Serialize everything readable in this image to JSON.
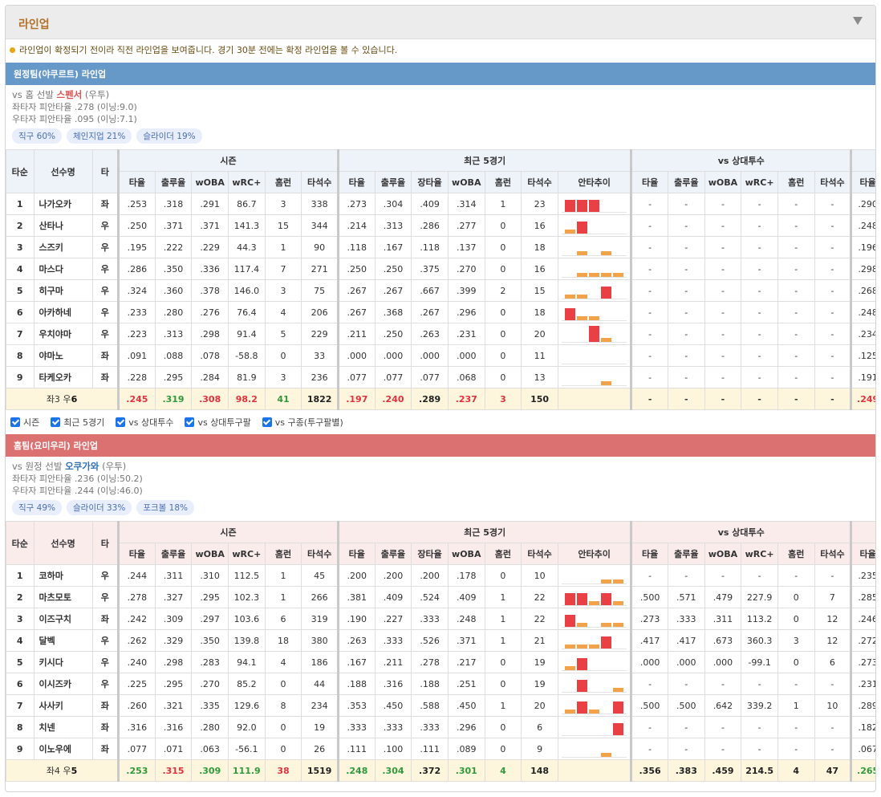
{
  "panel": {
    "title": "라인업",
    "notice": "라인업이 확정되기 전이라 직전 라인업을 보여줍니다. 경기 30분 전에는 확정 라인업을 볼 수 있습니다."
  },
  "colors": {
    "away_bar": "#6698c8",
    "home_bar": "#dc7171",
    "total_row": "#fdf6dc",
    "bar_red": "#e84045",
    "bar_orange": "#f2a34a",
    "accent_title": "#b2722a"
  },
  "headers": {
    "order": "타순",
    "name": "선수명",
    "hand": "타",
    "season": "시즌",
    "recent": "최근 5경기",
    "vs_pitcher": "vs 상대투수",
    "avg": "타율",
    "obp": "출루율",
    "slg": "장타율",
    "woba": "wOBA",
    "wrc": "wRC+",
    "hr": "홈런",
    "ab": "타석수",
    "trend": "안타추이"
  },
  "filters": [
    "시즌",
    "최근 5경기",
    "vs 상대투수",
    "vs 상대투구팔",
    "vs 구종(투구팔별)"
  ],
  "away": {
    "title": "원정팀(야쿠르트) 라인업",
    "vs_prefix": "vs 홈 선발 ",
    "pitcher_name": "스펜서",
    "pitcher_hand": " (우투)",
    "split_left": "좌타자 피안타율 .278 (이닝:9.0)",
    "split_right": "우타자 피안타율 .095 (이닝:7.1)",
    "tags": [
      "직구 60%",
      "체인지업 21%",
      "슬라이더 19%"
    ],
    "rows": [
      {
        "order": "1",
        "name": "나가오카",
        "hand": "좌",
        "s": [
          ".253",
          ".318",
          ".291",
          "86.7",
          "3",
          "338"
        ],
        "r": [
          ".273",
          ".304",
          ".409",
          ".314",
          "1",
          "23"
        ],
        "trend": [
          "r3",
          "r3",
          "r3",
          "n",
          "n"
        ],
        "v": [
          "-",
          "-",
          "-",
          "-",
          "-",
          "-"
        ],
        "last": ".290"
      },
      {
        "order": "2",
        "name": "산타나",
        "hand": "우",
        "s": [
          ".250",
          ".371",
          ".371",
          "141.3",
          "15",
          "344"
        ],
        "r": [
          ".214",
          ".313",
          ".286",
          ".277",
          "0",
          "16"
        ],
        "trend": [
          "o1",
          "r3",
          "n",
          "n",
          "n"
        ],
        "v": [
          "-",
          "-",
          "-",
          "-",
          "-",
          "-"
        ],
        "last": ".248"
      },
      {
        "order": "3",
        "name": "스즈키",
        "hand": "우",
        "s": [
          ".195",
          ".222",
          ".229",
          "44.3",
          "1",
          "90"
        ],
        "r": [
          ".118",
          ".167",
          ".118",
          ".137",
          "0",
          "18"
        ],
        "trend": [
          "n",
          "o1",
          "n",
          "o1",
          "n"
        ],
        "v": [
          "-",
          "-",
          "-",
          "-",
          "-",
          "-"
        ],
        "last": ".196"
      },
      {
        "order": "4",
        "name": "마스다",
        "hand": "우",
        "s": [
          ".286",
          ".350",
          ".336",
          "117.4",
          "7",
          "271"
        ],
        "r": [
          ".250",
          ".250",
          ".375",
          ".270",
          "0",
          "16"
        ],
        "trend": [
          "n",
          "o1",
          "o1",
          "o1",
          "o1"
        ],
        "v": [
          "-",
          "-",
          "-",
          "-",
          "-",
          "-"
        ],
        "last": ".298"
      },
      {
        "order": "5",
        "name": "히구마",
        "hand": "우",
        "s": [
          ".324",
          ".360",
          ".378",
          "146.0",
          "3",
          "75"
        ],
        "r": [
          ".267",
          ".267",
          ".667",
          ".399",
          "2",
          "15"
        ],
        "trend": [
          "o1",
          "o1",
          "n",
          "r3",
          "n"
        ],
        "v": [
          "-",
          "-",
          "-",
          "-",
          "-",
          "-"
        ],
        "last": ".268"
      },
      {
        "order": "6",
        "name": "아카하네",
        "hand": "우",
        "s": [
          ".233",
          ".280",
          ".276",
          "76.4",
          "4",
          "206"
        ],
        "r": [
          ".267",
          ".368",
          ".267",
          ".296",
          "0",
          "18"
        ],
        "trend": [
          "r3",
          "o1",
          "o1",
          "n",
          "n"
        ],
        "v": [
          "-",
          "-",
          "-",
          "-",
          "-",
          "-"
        ],
        "last": ".248"
      },
      {
        "order": "7",
        "name": "우치야마",
        "hand": "우",
        "s": [
          ".223",
          ".313",
          ".298",
          "91.4",
          "5",
          "229"
        ],
        "r": [
          ".211",
          ".250",
          ".263",
          ".231",
          "0",
          "20"
        ],
        "trend": [
          "n",
          "n",
          "r4",
          "o1",
          "n"
        ],
        "v": [
          "-",
          "-",
          "-",
          "-",
          "-",
          "-"
        ],
        "last": ".234"
      },
      {
        "order": "8",
        "name": "야마노",
        "hand": "좌",
        "s": [
          ".091",
          ".088",
          ".078",
          "-58.8",
          "0",
          "33"
        ],
        "r": [
          ".000",
          ".000",
          ".000",
          ".000",
          "0",
          "11"
        ],
        "trend": [
          "n",
          "n",
          "n",
          "n",
          "n"
        ],
        "v": [
          "-",
          "-",
          "-",
          "-",
          "-",
          "-"
        ],
        "last": ".125"
      },
      {
        "order": "9",
        "name": "타케오카",
        "hand": "좌",
        "s": [
          ".228",
          ".295",
          ".284",
          "81.9",
          "3",
          "236"
        ],
        "r": [
          ".077",
          ".077",
          ".077",
          ".068",
          "0",
          "13"
        ],
        "trend": [
          "n",
          "n",
          "n",
          "o1",
          "n"
        ],
        "v": [
          "-",
          "-",
          "-",
          "-",
          "-",
          "-"
        ],
        "last": ".191"
      }
    ],
    "total": {
      "label_pre": "좌3 우",
      "label_num": "6",
      "s": [
        ".245",
        ".319",
        ".308",
        "98.2",
        "41",
        "1822"
      ],
      "r": [
        ".197",
        ".240",
        ".289",
        ".237",
        "3",
        "150"
      ],
      "v": [
        "-",
        "-",
        "-",
        "-",
        "-",
        "-"
      ],
      "last": ".249"
    }
  },
  "home": {
    "title": "홈팀(요미우리) 라인업",
    "vs_prefix": "vs 원정 선발 ",
    "pitcher_name": "오쿠가와",
    "pitcher_hand": " (우투)",
    "split_left": "좌타자 피안타율 .236 (이닝:50.2)",
    "split_right": "우타자 피안타율 .244 (이닝:46.0)",
    "tags": [
      "직구 49%",
      "슬라이더 33%",
      "포크볼 18%"
    ],
    "rows": [
      {
        "order": "1",
        "name": "코하마",
        "hand": "우",
        "s": [
          ".244",
          ".311",
          ".310",
          "112.5",
          "1",
          "45"
        ],
        "r": [
          ".200",
          ".200",
          ".200",
          ".178",
          "0",
          "10"
        ],
        "trend": [
          "n",
          "n",
          "n",
          "o1",
          "o1"
        ],
        "v": [
          "-",
          "-",
          "-",
          "-",
          "-",
          "-"
        ],
        "last": ".235"
      },
      {
        "order": "2",
        "name": "마츠모토",
        "hand": "우",
        "s": [
          ".278",
          ".327",
          ".295",
          "102.3",
          "1",
          "266"
        ],
        "r": [
          ".381",
          ".409",
          ".524",
          ".409",
          "1",
          "22"
        ],
        "trend": [
          "r3",
          "r3",
          "o1",
          "r3",
          "o1"
        ],
        "v": [
          ".500",
          ".571",
          ".479",
          "227.9",
          "0",
          "7"
        ],
        "last": ".285"
      },
      {
        "order": "3",
        "name": "이즈구치",
        "hand": "좌",
        "s": [
          ".242",
          ".309",
          ".297",
          "103.6",
          "6",
          "319"
        ],
        "r": [
          ".190",
          ".227",
          ".333",
          ".248",
          "1",
          "22"
        ],
        "trend": [
          "r3",
          "o1",
          "n",
          "o1",
          "o1"
        ],
        "v": [
          ".273",
          ".333",
          ".311",
          "113.2",
          "0",
          "12"
        ],
        "last": ".246"
      },
      {
        "order": "4",
        "name": "달벡",
        "hand": "우",
        "s": [
          ".262",
          ".329",
          ".350",
          "139.8",
          "18",
          "380"
        ],
        "r": [
          ".263",
          ".333",
          ".526",
          ".371",
          "1",
          "21"
        ],
        "trend": [
          "o1",
          "o1",
          "o1",
          "r3",
          "n"
        ],
        "v": [
          ".417",
          ".417",
          ".673",
          "360.3",
          "3",
          "12"
        ],
        "last": ".272"
      },
      {
        "order": "5",
        "name": "키시다",
        "hand": "우",
        "s": [
          ".240",
          ".298",
          ".283",
          "94.1",
          "4",
          "186"
        ],
        "r": [
          ".167",
          ".211",
          ".278",
          ".217",
          "0",
          "19"
        ],
        "trend": [
          "o1",
          "r3",
          "n",
          "n",
          "n"
        ],
        "v": [
          ".000",
          ".000",
          ".000",
          "-99.1",
          "0",
          "6"
        ],
        "last": ".273"
      },
      {
        "order": "6",
        "name": "이시즈카",
        "hand": "우",
        "s": [
          ".225",
          ".295",
          ".270",
          "85.2",
          "0",
          "44"
        ],
        "r": [
          ".188",
          ".316",
          ".188",
          ".251",
          "0",
          "19"
        ],
        "trend": [
          "n",
          "r3",
          "n",
          "n",
          "o1"
        ],
        "v": [
          "-",
          "-",
          "-",
          "-",
          "-",
          "-"
        ],
        "last": ".231"
      },
      {
        "order": "7",
        "name": "사사키",
        "hand": "좌",
        "s": [
          ".260",
          ".321",
          ".335",
          "129.6",
          "8",
          "234"
        ],
        "r": [
          ".353",
          ".450",
          ".588",
          ".450",
          "1",
          "20"
        ],
        "trend": [
          "o1",
          "r3",
          "o1",
          "n",
          "r3"
        ],
        "v": [
          ".500",
          ".500",
          ".642",
          "339.2",
          "1",
          "10"
        ],
        "last": ".289"
      },
      {
        "order": "8",
        "name": "치넨",
        "hand": "좌",
        "s": [
          ".316",
          ".316",
          ".280",
          "92.0",
          "0",
          "19"
        ],
        "r": [
          ".333",
          ".333",
          ".333",
          ".296",
          "0",
          "6"
        ],
        "trend": [
          "n",
          "n",
          "n",
          "n",
          "r3"
        ],
        "v": [
          "-",
          "-",
          "-",
          "-",
          "-",
          "-"
        ],
        "last": ".182"
      },
      {
        "order": "9",
        "name": "이노우에",
        "hand": "좌",
        "s": [
          ".077",
          ".071",
          ".063",
          "-56.1",
          "0",
          "26"
        ],
        "r": [
          ".111",
          ".100",
          ".111",
          ".089",
          "0",
          "9"
        ],
        "trend": [
          "n",
          "n",
          "n",
          "o1",
          "n"
        ],
        "v": [
          "-",
          "-",
          "-",
          "-",
          "-",
          "-"
        ],
        "last": ".067"
      }
    ],
    "total": {
      "label_pre": "좌4 우",
      "label_num": "5",
      "s": [
        ".253",
        ".315",
        ".309",
        "111.9",
        "38",
        "1519"
      ],
      "r": [
        ".248",
        ".304",
        ".372",
        ".301",
        "4",
        "148"
      ],
      "v": [
        ".356",
        ".383",
        ".459",
        "214.5",
        "4",
        "47"
      ],
      "last": ".265"
    }
  }
}
